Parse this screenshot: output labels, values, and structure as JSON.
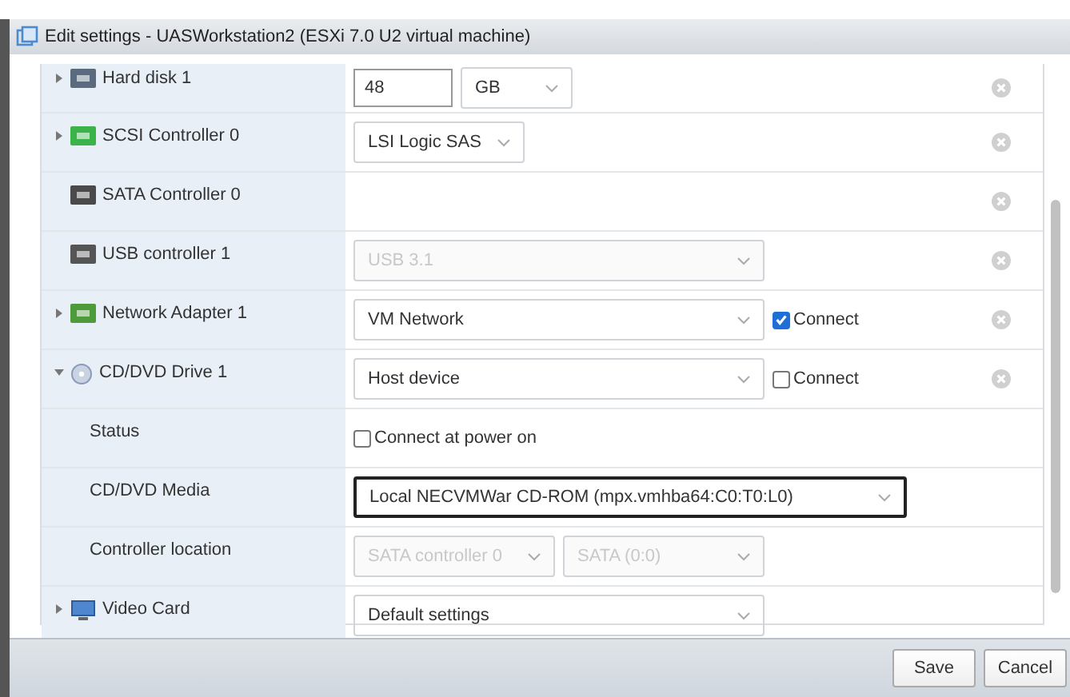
{
  "window": {
    "title": "Edit settings - UASWorkstation2 (ESXi 7.0 U2 virtual machine)"
  },
  "devices": [
    {
      "label": "Hard disk 1",
      "kind": "disk",
      "expanded": false,
      "removable": true,
      "controls": [
        {
          "kind": "input",
          "value": "48"
        },
        {
          "kind": "compact-dropdown",
          "value": "GB",
          "disabled": false,
          "focused": false
        }
      ]
    },
    {
      "label": "SCSI Controller 0",
      "kind": "scsi",
      "expanded": false,
      "removable": true,
      "controls": [
        {
          "kind": "compact-dropdown",
          "value": "LSI Logic SAS",
          "disabled": false,
          "focused": false
        }
      ]
    },
    {
      "label": "SATA Controller 0",
      "kind": "sata",
      "removable": true
    },
    {
      "label": "USB controller 1",
      "kind": "usb",
      "removable": true,
      "controls": [
        {
          "kind": "dropdown",
          "value": "USB 3.1",
          "disabled": true,
          "focused": false
        }
      ]
    },
    {
      "label": "Network Adapter 1",
      "kind": "network",
      "expanded": false,
      "removable": true,
      "controls": [
        {
          "kind": "dropdown",
          "value": "VM Network",
          "disabled": false,
          "focused": false
        },
        {
          "kind": "checkbox",
          "label": "Connect",
          "checked": true
        }
      ]
    },
    {
      "label": "CD/DVD Drive 1",
      "kind": "cd",
      "expanded": true,
      "removable": true,
      "controls": [
        {
          "kind": "dropdown",
          "value": "Host device",
          "disabled": false,
          "focused": false
        },
        {
          "kind": "checkbox",
          "label": "Connect",
          "checked": false
        }
      ],
      "children": [
        {
          "label": "Status",
          "removable": false,
          "controls": [
            {
              "kind": "checkbox",
              "label": "Connect at power on",
              "checked": false
            }
          ]
        },
        {
          "label": "CD/DVD Media",
          "removable": false,
          "controls": [
            {
              "kind": "dropdown",
              "value": "Local NECVMWar CD-ROM (mpx.vmhba64:C0:T0:L0)",
              "disabled": false,
              "focused": true
            }
          ]
        },
        {
          "label": "Controller location",
          "removable": false,
          "controls": [
            {
              "kind": "half-dropdown",
              "value": "SATA controller 0",
              "disabled": true,
              "focused": false
            },
            {
              "kind": "half-dropdown",
              "value": "SATA (0:0)",
              "disabled": true,
              "focused": false
            }
          ]
        }
      ]
    },
    {
      "label": "Video Card",
      "kind": "monitor",
      "expanded": false,
      "removable": false,
      "controls": [
        {
          "kind": "dropdown",
          "value": "Default settings",
          "disabled": false,
          "focused": false
        }
      ]
    }
  ],
  "buttons": [
    {
      "label": "Save"
    },
    {
      "label": "Cancel"
    }
  ]
}
